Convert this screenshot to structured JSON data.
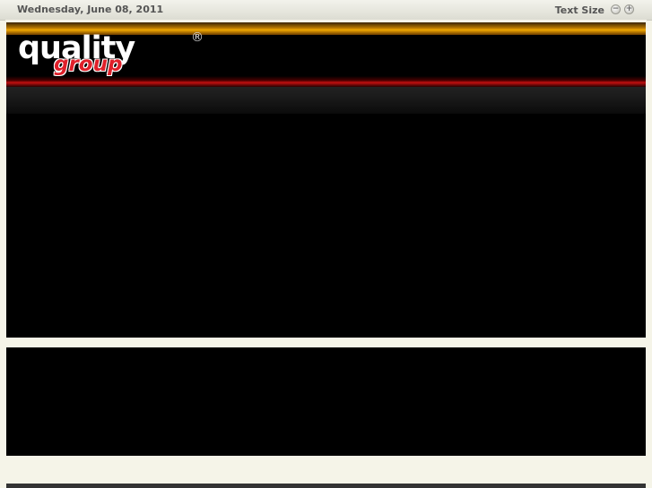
{
  "topbar": {
    "date": "Wednesday, June 08, 2011",
    "text_size_label": "Text Size",
    "decrease_symbol": "−",
    "increase_symbol": "+"
  },
  "logo": {
    "word1": "quality",
    "word2": "group",
    "registered": "®"
  },
  "colors": {
    "accent_orange": "#f0a800",
    "accent_red": "#e0202a",
    "background": "#f5f4e8"
  }
}
